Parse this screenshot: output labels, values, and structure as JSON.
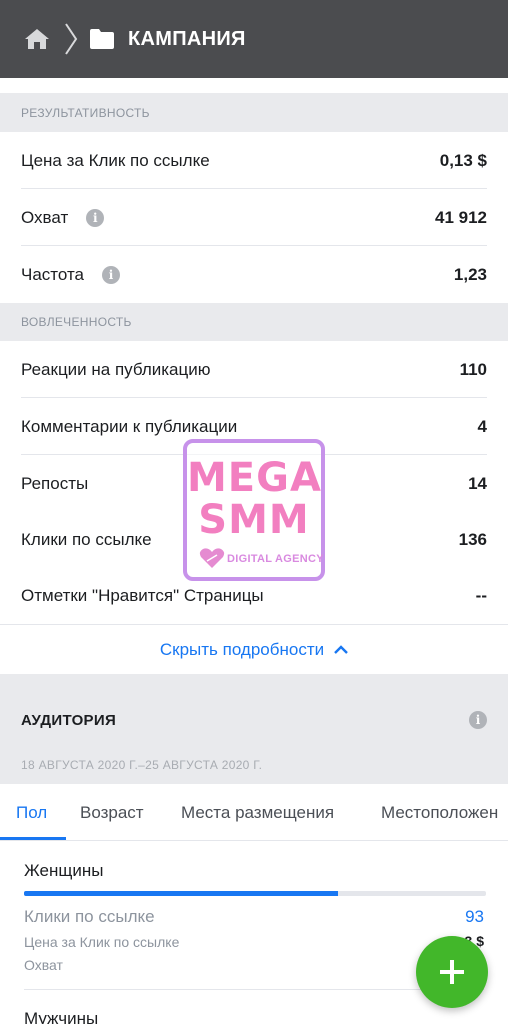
{
  "header": {
    "title": "КАМПАНИЯ",
    "icons": [
      "home-icon",
      "chevron-right-icon",
      "folder-icon"
    ],
    "background": "#4b4c4f"
  },
  "performance": {
    "section_title": "РЕЗУЛЬТАТИВНОСТЬ",
    "rows": [
      {
        "label": "Цена за Клик по ссылке",
        "value": "0,13 $",
        "info": false
      },
      {
        "label": "Охват",
        "value": "41 912",
        "info": true
      },
      {
        "label": "Частота",
        "value": "1,23",
        "info": true
      }
    ]
  },
  "engagement": {
    "section_title": "ВОВЛЕЧЕННОСТЬ",
    "rows": [
      {
        "label": "Реакции на публикацию",
        "value": "110"
      },
      {
        "label": "Комментарии к публикации",
        "value": "4"
      },
      {
        "label": "Репосты",
        "value": "14"
      },
      {
        "label": "Клики по ссылке",
        "value": "136"
      },
      {
        "label": "Отметки \"Нравится\" Страницы",
        "value": "--"
      }
    ]
  },
  "hide_details": {
    "label": "Скрыть подробности",
    "icon": "chevron-up-icon",
    "color": "#1877f2"
  },
  "audience": {
    "title": "АУДИТОРИЯ",
    "date_range": "18 АВГУСТА 2020 Г.–25 АВГУСТА 2020 Г.",
    "tabs": [
      "Пол",
      "Возраст",
      "Места размещения",
      "Местоположен"
    ],
    "active_tab": 0,
    "groups": [
      {
        "name": "Женщины",
        "bar_fraction": 0.68,
        "clicks_label": "Клики по ссылке",
        "clicks_value": "93",
        "cpc_label": "Цена за Клик по ссылке",
        "cpc_value": "3 $",
        "reach_label": "Охват"
      },
      {
        "name": "Мужчины"
      }
    ]
  },
  "fab": {
    "icon": "plus-icon",
    "color": "#42b72a"
  },
  "watermark": {
    "line1": "MEGA",
    "line2": "SMM",
    "sub": "DIGITAL AGENCY"
  }
}
